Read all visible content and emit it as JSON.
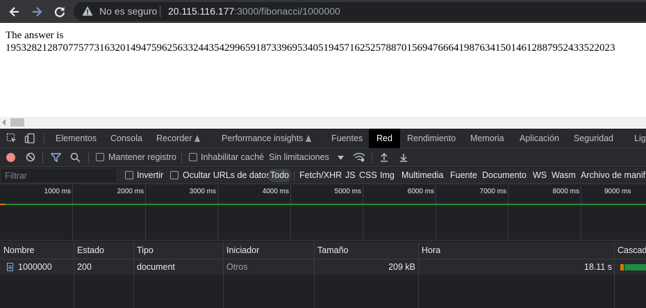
{
  "browser": {
    "back_icon": "arrow-left-icon",
    "forward_icon": "arrow-right-icon",
    "reload_icon": "reload-icon",
    "security_icon": "warning-triangle-icon",
    "security_text": "No es seguro",
    "url_host": "20.115.116.177",
    "url_path": ":3000/fibonacci/1000000"
  },
  "page": {
    "answer_label": "The answer is",
    "answer_value": "195328212870775773163201494759625633244354299659187339695340519457162525788701569476664198763415014612887952433522023"
  },
  "devtools": {
    "tabs": [
      "Elementos",
      "Consola",
      "Recorder",
      "Performance insights",
      "Fuentes",
      "Red",
      "Rendimiento",
      "Memoria",
      "Aplicación",
      "Seguridad",
      "Lighthouse"
    ],
    "active_tab": "Red",
    "toolbar": {
      "preserve_log": "Mantener registro",
      "disable_cache": "Inhabilitar caché",
      "throttling": "Sin limitaciones"
    },
    "filter": {
      "placeholder": "Filtrar",
      "invert": "Invertir",
      "hide_data_urls": "Ocultar URLs de datos",
      "types": [
        "Todo",
        "Fetch/XHR",
        "JS",
        "CSS",
        "Img",
        "Multimedia",
        "Fuente",
        "Documento",
        "WS",
        "Wasm",
        "Archivo de manifiesto"
      ],
      "active_type": "Todo"
    },
    "overview_ticks": [
      "1000 ms",
      "2000 ms",
      "3000 ms",
      "4000 ms",
      "5000 ms",
      "6000 ms",
      "7000 ms",
      "8000 ms",
      "9000 ms"
    ],
    "columns": [
      "Nombre",
      "Estado",
      "Tipo",
      "Iniciador",
      "Tamaño",
      "Hora",
      "Cascada"
    ],
    "rows": [
      {
        "name": "1000000",
        "status": "200",
        "type": "document",
        "initiator": "Otros",
        "size": "209 kB",
        "time": "18.11 s"
      }
    ],
    "colors": {
      "green": "#1e8e3e",
      "orange": "#e37400",
      "active_tab_bg": "#000000"
    }
  }
}
